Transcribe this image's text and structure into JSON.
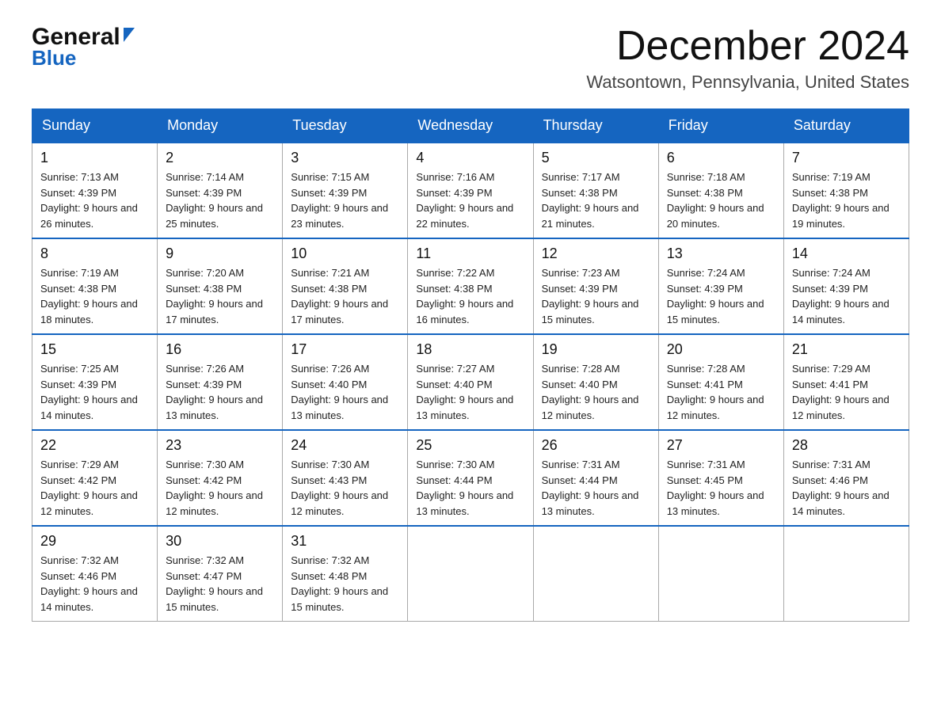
{
  "logo": {
    "general": "General",
    "blue": "Blue",
    "arrow": "▶"
  },
  "title": {
    "month_year": "December 2024",
    "location": "Watsontown, Pennsylvania, United States"
  },
  "weekdays": [
    "Sunday",
    "Monday",
    "Tuesday",
    "Wednesday",
    "Thursday",
    "Friday",
    "Saturday"
  ],
  "weeks": [
    [
      {
        "day": "1",
        "sunrise": "7:13 AM",
        "sunset": "4:39 PM",
        "daylight": "9 hours and 26 minutes."
      },
      {
        "day": "2",
        "sunrise": "7:14 AM",
        "sunset": "4:39 PM",
        "daylight": "9 hours and 25 minutes."
      },
      {
        "day": "3",
        "sunrise": "7:15 AM",
        "sunset": "4:39 PM",
        "daylight": "9 hours and 23 minutes."
      },
      {
        "day": "4",
        "sunrise": "7:16 AM",
        "sunset": "4:39 PM",
        "daylight": "9 hours and 22 minutes."
      },
      {
        "day": "5",
        "sunrise": "7:17 AM",
        "sunset": "4:38 PM",
        "daylight": "9 hours and 21 minutes."
      },
      {
        "day": "6",
        "sunrise": "7:18 AM",
        "sunset": "4:38 PM",
        "daylight": "9 hours and 20 minutes."
      },
      {
        "day": "7",
        "sunrise": "7:19 AM",
        "sunset": "4:38 PM",
        "daylight": "9 hours and 19 minutes."
      }
    ],
    [
      {
        "day": "8",
        "sunrise": "7:19 AM",
        "sunset": "4:38 PM",
        "daylight": "9 hours and 18 minutes."
      },
      {
        "day": "9",
        "sunrise": "7:20 AM",
        "sunset": "4:38 PM",
        "daylight": "9 hours and 17 minutes."
      },
      {
        "day": "10",
        "sunrise": "7:21 AM",
        "sunset": "4:38 PM",
        "daylight": "9 hours and 17 minutes."
      },
      {
        "day": "11",
        "sunrise": "7:22 AM",
        "sunset": "4:38 PM",
        "daylight": "9 hours and 16 minutes."
      },
      {
        "day": "12",
        "sunrise": "7:23 AM",
        "sunset": "4:39 PM",
        "daylight": "9 hours and 15 minutes."
      },
      {
        "day": "13",
        "sunrise": "7:24 AM",
        "sunset": "4:39 PM",
        "daylight": "9 hours and 15 minutes."
      },
      {
        "day": "14",
        "sunrise": "7:24 AM",
        "sunset": "4:39 PM",
        "daylight": "9 hours and 14 minutes."
      }
    ],
    [
      {
        "day": "15",
        "sunrise": "7:25 AM",
        "sunset": "4:39 PM",
        "daylight": "9 hours and 14 minutes."
      },
      {
        "day": "16",
        "sunrise": "7:26 AM",
        "sunset": "4:39 PM",
        "daylight": "9 hours and 13 minutes."
      },
      {
        "day": "17",
        "sunrise": "7:26 AM",
        "sunset": "4:40 PM",
        "daylight": "9 hours and 13 minutes."
      },
      {
        "day": "18",
        "sunrise": "7:27 AM",
        "sunset": "4:40 PM",
        "daylight": "9 hours and 13 minutes."
      },
      {
        "day": "19",
        "sunrise": "7:28 AM",
        "sunset": "4:40 PM",
        "daylight": "9 hours and 12 minutes."
      },
      {
        "day": "20",
        "sunrise": "7:28 AM",
        "sunset": "4:41 PM",
        "daylight": "9 hours and 12 minutes."
      },
      {
        "day": "21",
        "sunrise": "7:29 AM",
        "sunset": "4:41 PM",
        "daylight": "9 hours and 12 minutes."
      }
    ],
    [
      {
        "day": "22",
        "sunrise": "7:29 AM",
        "sunset": "4:42 PM",
        "daylight": "9 hours and 12 minutes."
      },
      {
        "day": "23",
        "sunrise": "7:30 AM",
        "sunset": "4:42 PM",
        "daylight": "9 hours and 12 minutes."
      },
      {
        "day": "24",
        "sunrise": "7:30 AM",
        "sunset": "4:43 PM",
        "daylight": "9 hours and 12 minutes."
      },
      {
        "day": "25",
        "sunrise": "7:30 AM",
        "sunset": "4:44 PM",
        "daylight": "9 hours and 13 minutes."
      },
      {
        "day": "26",
        "sunrise": "7:31 AM",
        "sunset": "4:44 PM",
        "daylight": "9 hours and 13 minutes."
      },
      {
        "day": "27",
        "sunrise": "7:31 AM",
        "sunset": "4:45 PM",
        "daylight": "9 hours and 13 minutes."
      },
      {
        "day": "28",
        "sunrise": "7:31 AM",
        "sunset": "4:46 PM",
        "daylight": "9 hours and 14 minutes."
      }
    ],
    [
      {
        "day": "29",
        "sunrise": "7:32 AM",
        "sunset": "4:46 PM",
        "daylight": "9 hours and 14 minutes."
      },
      {
        "day": "30",
        "sunrise": "7:32 AM",
        "sunset": "4:47 PM",
        "daylight": "9 hours and 15 minutes."
      },
      {
        "day": "31",
        "sunrise": "7:32 AM",
        "sunset": "4:48 PM",
        "daylight": "9 hours and 15 minutes."
      },
      null,
      null,
      null,
      null
    ]
  ],
  "labels": {
    "sunrise": "Sunrise: ",
    "sunset": "Sunset: ",
    "daylight": "Daylight: "
  }
}
